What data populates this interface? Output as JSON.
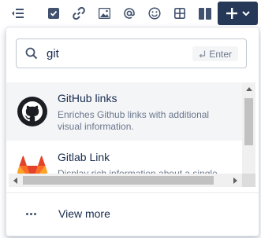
{
  "toolbar": {
    "icons": [
      "list-outdent-icon",
      "checkbox-icon",
      "link-icon",
      "image-icon",
      "mention-icon",
      "emoji-icon",
      "table-icon",
      "layout-icon"
    ],
    "insert_button": {
      "icons": [
        "plus-icon",
        "chevron-down-icon"
      ]
    }
  },
  "search": {
    "value": "git",
    "enter_hint": "Enter"
  },
  "results": [
    {
      "title": "GitHub links",
      "description": "Enriches Github links with additional visual information.",
      "icon": "github-icon"
    },
    {
      "title": "Gitlab Link",
      "description": "Display rich information about a single",
      "icon": "gitlab-icon"
    }
  ],
  "footer": {
    "view_more": "View more",
    "icon": "more-icon"
  },
  "colors": {
    "accent": "#253858",
    "text": "#172b4d",
    "muted": "#6b778c",
    "selected_bg": "#f4f5f7"
  }
}
